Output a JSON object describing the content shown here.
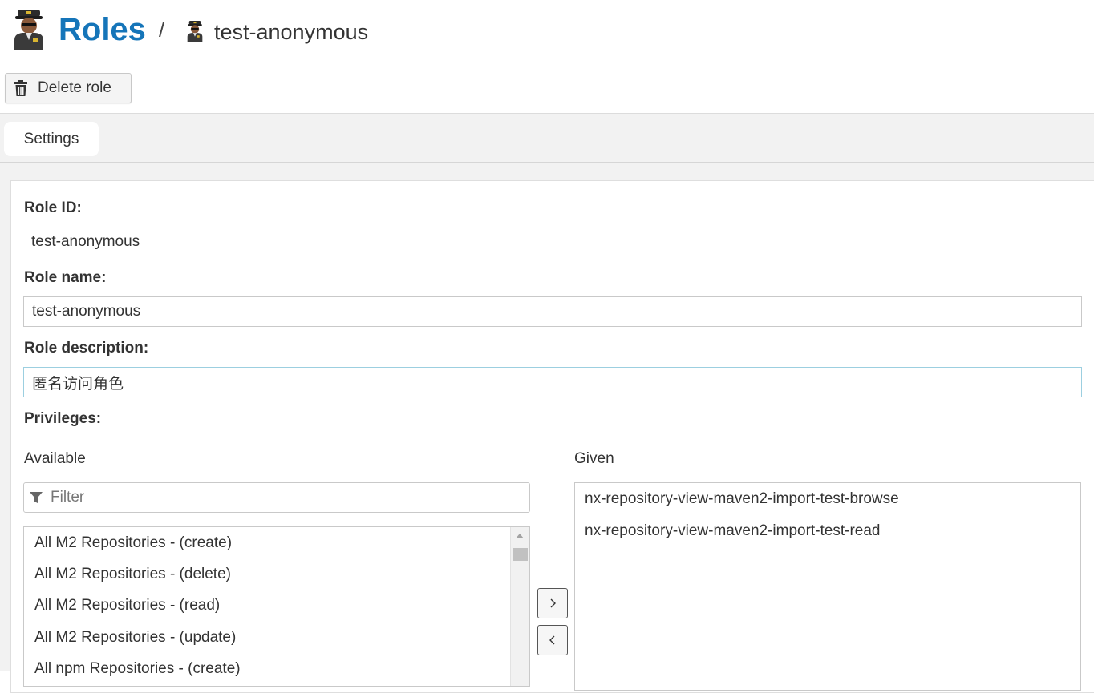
{
  "header": {
    "section_title": "Roles",
    "separator": "/",
    "item_title": "test-anonymous"
  },
  "toolbar": {
    "delete_label": "Delete role"
  },
  "tabs": [
    {
      "label": "Settings"
    }
  ],
  "form": {
    "role_id_label": "Role ID:",
    "role_id_value": "test-anonymous",
    "role_name_label": "Role name:",
    "role_name_value": "test-anonymous",
    "role_description_label": "Role description:",
    "role_description_value": "匿名访问角色",
    "privileges_label": "Privileges:"
  },
  "privileges": {
    "available_label": "Available",
    "given_label": "Given",
    "filter_placeholder": "Filter",
    "available_items": [
      "All M2 Repositories - (create)",
      "All M2 Repositories - (delete)",
      "All M2 Repositories - (read)",
      "All M2 Repositories - (update)",
      "All npm Repositories - (create)"
    ],
    "given_items": [
      "nx-repository-view-maven2-import-test-browse",
      "nx-repository-view-maven2-import-test-read"
    ],
    "add_symbol": "›",
    "remove_symbol": "‹"
  },
  "colors": {
    "accent": "#1575b9",
    "focus_border": "#9ccfe0"
  }
}
